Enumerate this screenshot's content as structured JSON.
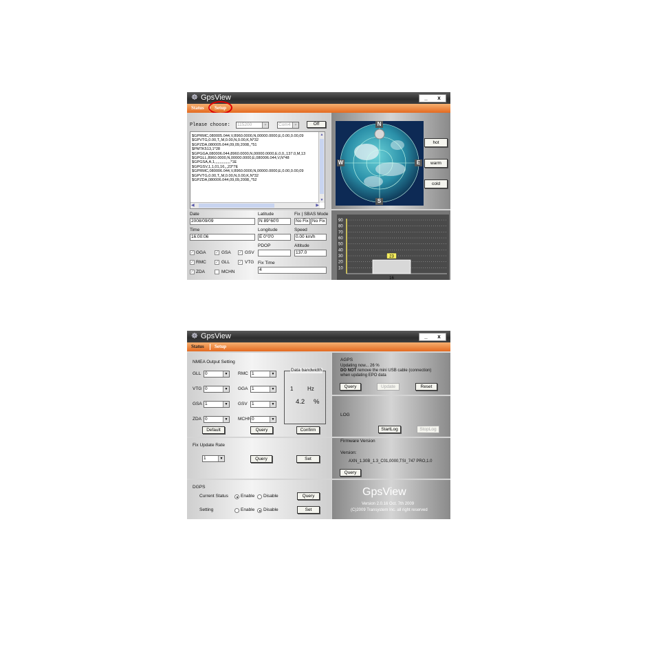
{
  "status_window": {
    "title": "GpsView",
    "window_buttons": [
      "_",
      "x"
    ],
    "menu": {
      "status": "Status",
      "setup": "Setup"
    },
    "please_choose_label": "Please choose:",
    "baud_value": "115200",
    "com_value": "Com4",
    "off_button": "Off",
    "nmea_lines": [
      "$GPRMC,080005.044,V,8960.0000,N,00000.0000,E,0.00,0.00,09",
      "$GPVTG,0.00,T,,M,0.00,N,0.00,K,N*32",
      "$GPZDA,080005.044,09,09,2008,,*51",
      "$PMTK513,1*28",
      "$GPGGA,080006.044,8960.0000,N,00000.0000,E,0,0,,137.0,M,13",
      "$GPGLL,8960.0000,N,00000.0000,E,080006.044,V,N*48",
      "$GPGSA,A,1,,,,,,,,,,,,,,,*1E",
      "$GPGSV,1,1,01,16,,,23*7E",
      "$GPRMC,080006.044,V,8960.0000,N,00000.0000,E,0.00,0.00,09",
      "$GPVTG,0.00,T,,M,0.00,N,0.00,K,N*32",
      "$GPZDA,080006.044,09,09,2008,,*52"
    ],
    "fields": {
      "date_label": "Date",
      "date_value": "2008/09/09",
      "time_label": "Time",
      "time_value": "16:00:06",
      "latitude_label": "Latitude",
      "latitude_value": "N 89°60'0",
      "longitude_label": "Longitude",
      "longitude_value": "E 0°0'0",
      "pdop_label": "PDOP",
      "pdop_value": "",
      "fixtime_label": "Fix Time",
      "fixtime_value": "4",
      "fix_sbas_label": "Fix | SBAS Mode",
      "fix_value": "No Fix",
      "sbas_value": "No Fix",
      "speed_label": "Speed",
      "speed_value": "0.00 km/h",
      "altitude_label": "Altitude",
      "altitude_value": "137.0"
    },
    "checkboxes": [
      "GGA",
      "GSA",
      "GSV",
      "RMC",
      "GLL",
      "VTG",
      "ZDA",
      "MCHN"
    ],
    "compass": {
      "n": "N",
      "s": "S",
      "w": "W",
      "e": "E"
    },
    "start_buttons": [
      "hot",
      "warm",
      "cold"
    ],
    "chart_data": {
      "type": "bar",
      "categories": [
        "16"
      ],
      "values": [
        23
      ],
      "ylim": [
        0,
        90
      ],
      "y_ticks": [
        "90",
        "80",
        "70",
        "60",
        "50",
        "40",
        "30",
        "20",
        "10"
      ],
      "data_labels": [
        "23"
      ]
    }
  },
  "setup_window": {
    "title": "GpsView",
    "menu": {
      "status": "Status",
      "setup": "Setup"
    },
    "nmea_section": {
      "title": "NMEA Output Setting",
      "rows": [
        {
          "l1": "GLL",
          "v1": "0",
          "l2": "RMC",
          "v2": "1"
        },
        {
          "l1": "VTG",
          "v1": "0",
          "l2": "GGA",
          "v2": "1"
        },
        {
          "l1": "GSA",
          "v1": "1",
          "l2": "GSV",
          "v2": "1"
        },
        {
          "l1": "ZDA",
          "v1": "0",
          "l2": "MCHN",
          "v2": "0"
        }
      ],
      "bandwidth_title": "Data bandwidth",
      "hz_value": "1",
      "hz_unit": "Hz",
      "pct_value": "4.2",
      "pct_unit": "%",
      "default_button": "Default",
      "query_button": "Query",
      "confirm_button": "Confirm"
    },
    "fix_update": {
      "title": "Fix Update Rate",
      "value": "1",
      "query_button": "Query",
      "set_button": "Set"
    },
    "dgps": {
      "title": "DGPS",
      "current_status_label": "Current Status",
      "setting_label": "Setting",
      "enable": "Enable",
      "disable": "Disable",
      "query_button": "Query",
      "set_button": "Set"
    },
    "agps": {
      "title": "AGPS",
      "line1": "Updating now... 26 %",
      "line2_bold": "DO NOT",
      "line2_rest": " remove the mini USB cable (connection)",
      "line3": "when updating EPO data",
      "query_button": "Query",
      "update_button": "Update",
      "reset_button": "Reset"
    },
    "log": {
      "title": "LOG",
      "start_button": "StartLog",
      "stop_button": "StopLog"
    },
    "firmware": {
      "title": "Firmware Version",
      "version_label": "Version:",
      "version_value": "AXN_1.30B_1.3_C01,0000,TSI_747 PRO,1.0",
      "query_button": "Query"
    },
    "branding": {
      "name": "GpsView",
      "version_line": "Version 2.0.16 Oct. 7th 2009",
      "copyright": "(C)2009 Transystem Inc. all right reserved"
    }
  }
}
